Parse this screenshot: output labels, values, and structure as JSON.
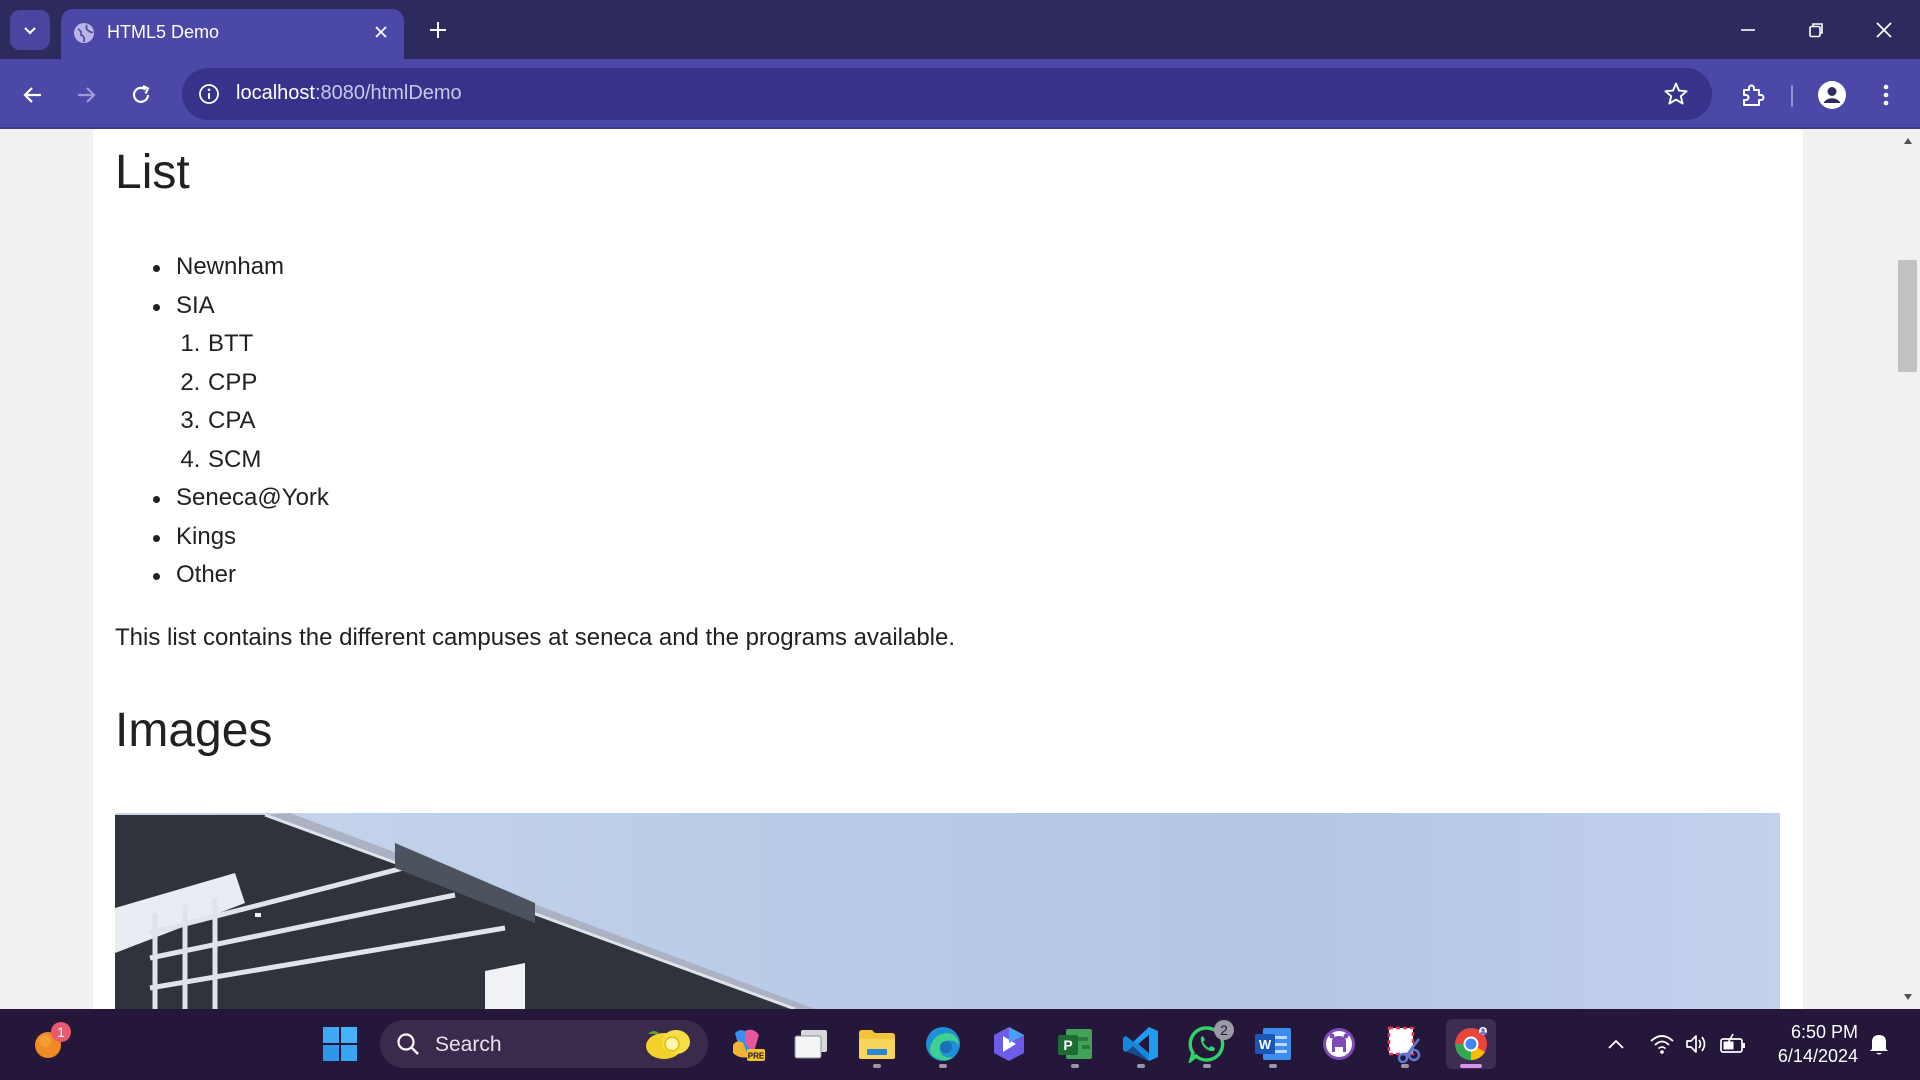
{
  "browser": {
    "tab_title": "HTML5 Demo",
    "url_host": "localhost",
    "url_path": ":8080/htmlDemo"
  },
  "page": {
    "list_heading": "List",
    "list_items": [
      {
        "label": "Newnham"
      },
      {
        "label": "SIA",
        "sub_items": [
          "BTT",
          "CPP",
          "CPA",
          "SCM"
        ]
      },
      {
        "label": "Seneca@York"
      },
      {
        "label": "Kings"
      },
      {
        "label": "Other"
      }
    ],
    "list_description": "This list contains the different campuses at seneca and the programs available.",
    "images_heading": "Images"
  },
  "taskbar": {
    "search_placeholder": "Search",
    "badges": {
      "notifications_app": "1",
      "whatsapp": "2"
    },
    "clock_time": "6:50 PM",
    "clock_date": "6/14/2024",
    "apps": [
      "copilot-icon",
      "task-view-icon",
      "file-explorer-icon",
      "edge-icon",
      "bing-icon",
      "project-icon",
      "vscode-icon",
      "whatsapp-icon",
      "word-icon",
      "github-icon",
      "snipping-tool-icon",
      "chrome-icon"
    ]
  },
  "colors": {
    "tabstrip": "#2d2a5e",
    "toolbar": "#4c48a8",
    "taskbar": "#25173a",
    "page_text": "#212121"
  }
}
